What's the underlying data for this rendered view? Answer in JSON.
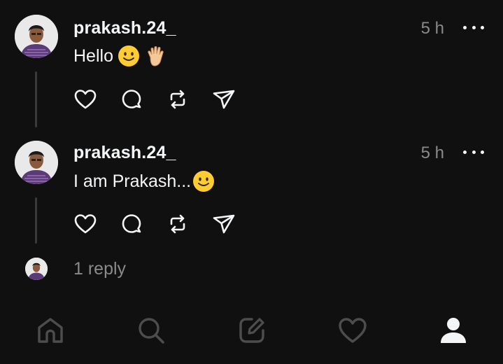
{
  "posts": [
    {
      "username": "prakash.24_",
      "time": "5 h",
      "text": "Hello",
      "emojis": [
        "slightly-smiling-face-emoji",
        "raised-hand-emoji"
      ]
    },
    {
      "username": "prakash.24_",
      "time": "5 h",
      "text": "I am Prakash...",
      "emojis": [
        "slightly-smiling-face-emoji"
      ]
    }
  ],
  "reply": {
    "label": "1 reply"
  },
  "actions": [
    "heart-icon",
    "comment-icon",
    "repost-icon",
    "share-icon"
  ],
  "nav": {
    "items": [
      "home-icon",
      "search-icon",
      "compose-icon",
      "activity-heart-icon",
      "profile-icon"
    ],
    "active": "profile-icon"
  },
  "colors": {
    "background": "#101010",
    "text": "#f3f5f7",
    "muted": "#8a8a8a",
    "nav_inactive": "#4d4d4d",
    "emoji": "#ffcc33"
  }
}
